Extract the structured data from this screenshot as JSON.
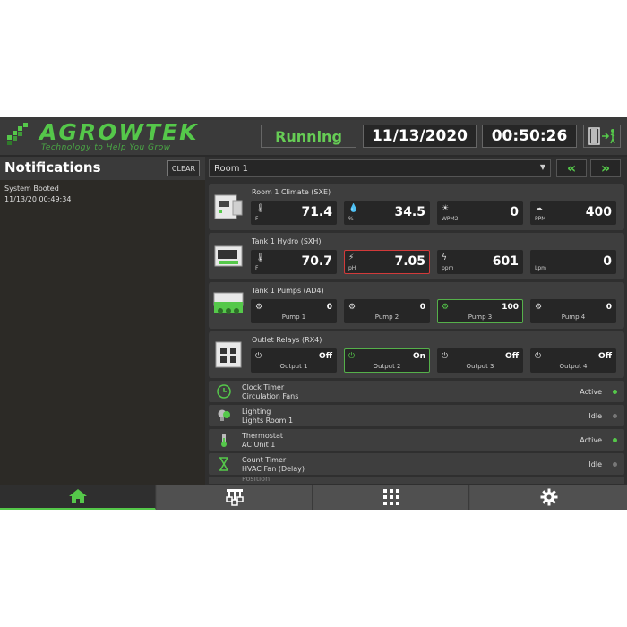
{
  "header": {
    "logo_text": "AGROWTEK",
    "logo_tagline": "Technology to Help You Grow",
    "status": "Running",
    "date": "11/13/2020",
    "time": "00:50:26",
    "exit_icon": "exit-door-icon",
    "status_color": "#66cc55"
  },
  "notifications": {
    "title": "Notifications",
    "clear_label": "CLEAR",
    "items": [
      {
        "message": "System Booted",
        "timestamp": "11/13/20 00:49:34"
      }
    ]
  },
  "room": {
    "selected": "Room 1",
    "prev_icon": "double-chevron-left-icon",
    "next_icon": "double-chevron-right-icon"
  },
  "devices": [
    {
      "title": "Room 1 Climate  (SXE)",
      "tiles": [
        {
          "icon": "thermometer-icon",
          "unit": "F",
          "value": "71.4"
        },
        {
          "icon": "humidity-icon",
          "unit": "%",
          "value": "34.5"
        },
        {
          "icon": "sun-icon",
          "unit": "WPM2",
          "value": "0"
        },
        {
          "icon": "cloud-co2-icon",
          "unit": "PPM",
          "value": "400"
        }
      ]
    },
    {
      "title": "Tank 1 Hydro  (SXH)",
      "tiles": [
        {
          "icon": "thermometer-icon",
          "unit": "F",
          "value": "70.7"
        },
        {
          "icon": "ph-icon",
          "unit": "pH",
          "value": "7.05",
          "state": "alert"
        },
        {
          "icon": "conductivity-icon",
          "unit": "ppm",
          "value": "601"
        },
        {
          "icon": "flow-icon",
          "unit": "Lpm",
          "value": "0"
        }
      ]
    },
    {
      "title": "Tank 1 Pumps  (AD4)",
      "tiles": [
        {
          "icon": "pump-icon",
          "label": "Pump 1",
          "value": "0"
        },
        {
          "icon": "pump-icon",
          "label": "Pump 2",
          "value": "0"
        },
        {
          "icon": "pump-icon",
          "label": "Pump 3",
          "value": "100",
          "state": "active"
        },
        {
          "icon": "pump-icon",
          "label": "Pump 4",
          "value": "0"
        }
      ]
    },
    {
      "title": "Outlet Relays  (RX4)",
      "tiles": [
        {
          "icon": "power-icon",
          "label": "Output 1",
          "value": "Off"
        },
        {
          "icon": "power-icon",
          "label": "Output 2",
          "value": "On",
          "state": "active"
        },
        {
          "icon": "power-icon",
          "label": "Output 3",
          "value": "Off"
        },
        {
          "icon": "power-icon",
          "label": "Output 4",
          "value": "Off"
        }
      ]
    }
  ],
  "timers": [
    {
      "type": "Clock Timer",
      "name": "Circulation Fans",
      "status": "Active",
      "icon": "clock-icon",
      "dot_color": "#55c84a"
    },
    {
      "type": "Lighting",
      "name": "Lights Room 1",
      "status": "Idle",
      "icon": "light-bulb-icon",
      "dot_color": "#777777"
    },
    {
      "type": "Thermostat",
      "name": "AC Unit 1",
      "status": "Active",
      "icon": "thermometer-icon",
      "dot_color": "#55c84a"
    },
    {
      "type": "Count Timer",
      "name": "HVAC Fan (Delay)",
      "status": "Idle",
      "icon": "hourglass-icon",
      "dot_color": "#777777"
    }
  ],
  "partial_timer": {
    "type": "Position"
  },
  "bottom_nav": [
    {
      "icon": "home-icon",
      "selected": true
    },
    {
      "icon": "device-network-icon"
    },
    {
      "icon": "grid-apps-icon"
    },
    {
      "icon": "gear-icon"
    }
  ],
  "colors": {
    "accent": "#55c84a",
    "alert": "#d23a3a",
    "panel": "#3e3e3e",
    "tile": "#262626"
  }
}
